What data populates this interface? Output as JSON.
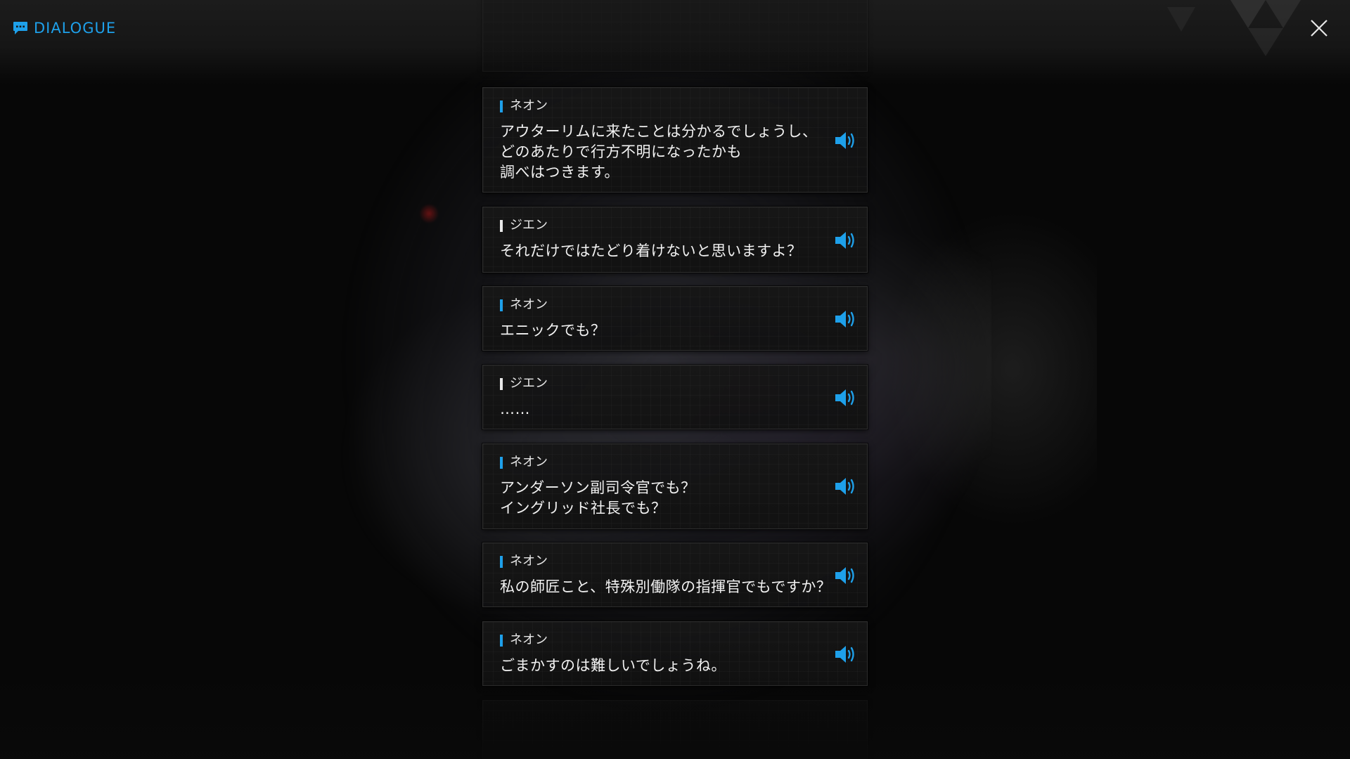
{
  "header": {
    "title": "DIALOGUE",
    "title_icon": "chat-bubble-icon",
    "close_icon": "close-icon"
  },
  "colors": {
    "accent": "#1ea0ea",
    "text": "#f2f2f2",
    "card_bg": "#151515"
  },
  "dialogue": [
    {
      "speaker": "ネオン",
      "text": "アウターリムに来たことは分かるでしょうし、\nどのあたりで行方不明になったかも\n調べはつきます。",
      "voice_icon": "speaker-icon"
    },
    {
      "speaker": "ジエン",
      "text": "それだけではたどり着けないと思いますよ？",
      "voice_icon": "speaker-icon"
    },
    {
      "speaker": "ネオン",
      "text": "エニックでも？",
      "voice_icon": "speaker-icon"
    },
    {
      "speaker": "ジエン",
      "text": "……",
      "voice_icon": "speaker-icon"
    },
    {
      "speaker": "ネオン",
      "text": "アンダーソン副司令官でも？\nイングリッド社長でも？",
      "voice_icon": "speaker-icon"
    },
    {
      "speaker": "ネオン",
      "text": "私の師匠こと、特殊別働隊の指揮官でもですか？",
      "voice_icon": "speaker-icon"
    },
    {
      "speaker": "ネオン",
      "text": "ごまかすのは難しいでしょうね。",
      "voice_icon": "speaker-icon"
    }
  ]
}
